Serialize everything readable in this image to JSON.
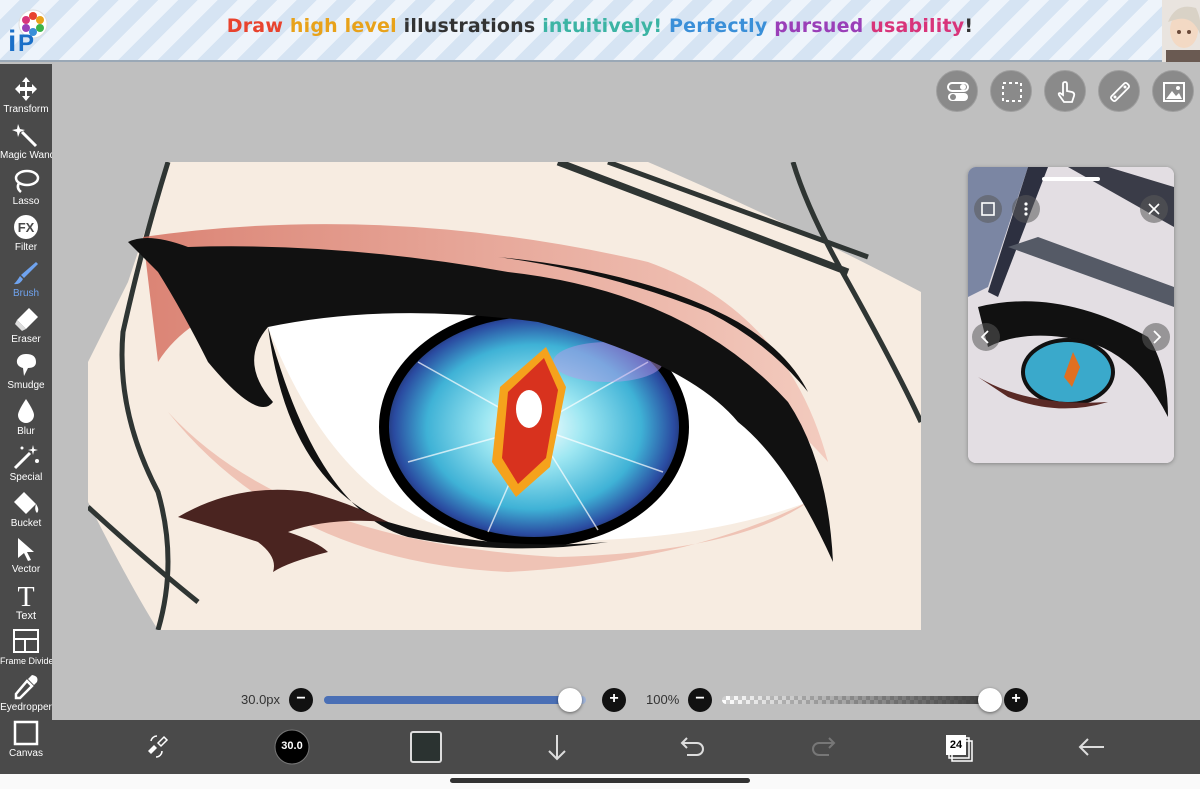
{
  "banner": {
    "segments": [
      {
        "text": "Draw ",
        "color": "#e8432e"
      },
      {
        "text": "high level ",
        "color": "#e8a21a"
      },
      {
        "text": "illustrations ",
        "color": "#333333"
      },
      {
        "text": "intuitively! ",
        "color": "#3cb4a4"
      },
      {
        "text": "Perfectly ",
        "color": "#3a8fd8"
      },
      {
        "text": "pursued ",
        "color": "#9a3fb8"
      },
      {
        "text": "usability",
        "color": "#d8347a"
      },
      {
        "text": "!",
        "color": "#333333"
      }
    ]
  },
  "tools": [
    {
      "label": "Transform",
      "icon": "transform-icon",
      "active": false
    },
    {
      "label": "Magic Wand",
      "icon": "magic-wand-icon",
      "active": false
    },
    {
      "label": "Lasso",
      "icon": "lasso-icon",
      "active": false
    },
    {
      "label": "Filter",
      "icon": "fx-icon",
      "active": false
    },
    {
      "label": "Brush",
      "icon": "brush-icon",
      "active": true
    },
    {
      "label": "Eraser",
      "icon": "eraser-icon",
      "active": false
    },
    {
      "label": "Smudge",
      "icon": "smudge-icon",
      "active": false
    },
    {
      "label": "Blur",
      "icon": "blur-drop-icon",
      "active": false
    },
    {
      "label": "Special",
      "icon": "special-wand-icon",
      "active": false
    },
    {
      "label": "Bucket",
      "icon": "bucket-icon",
      "active": false
    },
    {
      "label": "Vector",
      "icon": "vector-cursor-icon",
      "active": false
    },
    {
      "label": "Text",
      "icon": "text-icon",
      "active": false
    },
    {
      "label": "Frame Divider",
      "icon": "frame-divider-icon",
      "active": false
    },
    {
      "label": "Eyedropper",
      "icon": "eyedropper-icon",
      "active": false
    },
    {
      "label": "Canvas",
      "icon": "canvas-icon",
      "active": false
    }
  ],
  "top_buttons": [
    "toggle-icon",
    "selection-icon",
    "touch-gesture-icon",
    "ruler-icon",
    "reference-image-icon"
  ],
  "sliders": {
    "size": {
      "label": "30.0px",
      "fill": 0.94,
      "color": "#4a6fb5"
    },
    "opacity": {
      "label": "100%",
      "fill": 1.0
    }
  },
  "bottom": {
    "brush_size": "30.0",
    "color_swatch": "#2b3331",
    "layer_count": "24"
  },
  "colors": {
    "toolbar": "#4a4a4a",
    "active_tool": "#6fa3ef",
    "canvas_bg": "#bfbfbf",
    "skin": "#f7ece1"
  }
}
